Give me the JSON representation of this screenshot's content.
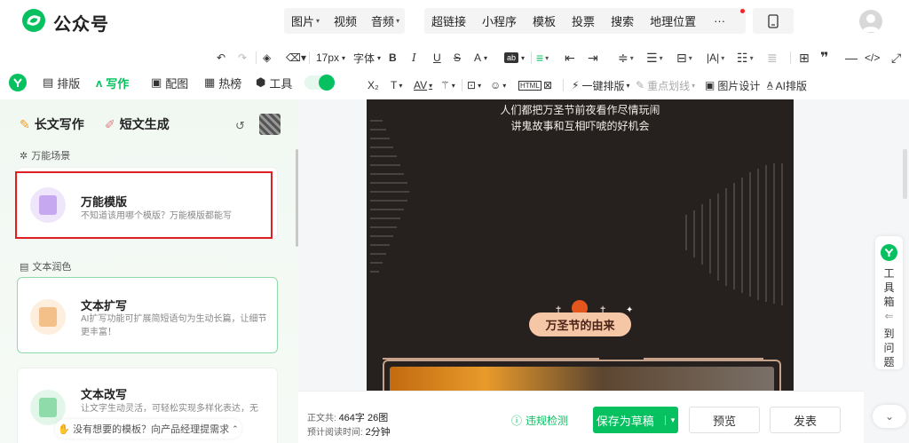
{
  "header": {
    "brand": "公众号",
    "media_menu": [
      "图片",
      "视频",
      "音频"
    ],
    "insert_menu": [
      "超链接",
      "小程序",
      "模板",
      "投票",
      "搜索",
      "地理位置"
    ],
    "more": "···"
  },
  "toolbar": {
    "font_size": "17px",
    "font_family": "字体",
    "bold": "B",
    "italic": "I",
    "underline": "U",
    "strike": "S",
    "text_color": "A",
    "row2": {
      "sub": "X₂",
      "text_style": "T",
      "spacing": "AV",
      "one_click_layout": "一键排版",
      "highlight": "重点划线",
      "image_design": "图片设计",
      "ai_layout": "AI排版"
    }
  },
  "tabs": [
    {
      "label": "排版",
      "icon": "layout-icon"
    },
    {
      "label": "写作",
      "icon": "ai-write-icon",
      "active": true
    },
    {
      "label": "配图",
      "icon": "image-icon"
    },
    {
      "label": "热榜",
      "icon": "hot-list-icon"
    },
    {
      "label": "工具",
      "icon": "tool-icon"
    }
  ],
  "left_panel": {
    "long_write": "长文写作",
    "short_generate": "短文生成",
    "section_universal": "万能场景",
    "section_polish": "文本润色",
    "cards": [
      {
        "title": "万能模版",
        "desc": "不知道该用哪个模版？万能模版都能写"
      },
      {
        "title": "文本扩写",
        "desc": "AI扩写功能可扩展简短语句为生动长篇，让细节更丰富！"
      },
      {
        "title": "文本改写",
        "desc": "让文字生动灵活，可轻松实现多样化表达，无"
      }
    ],
    "feedback": "没有想要的模板？向产品经理提需求"
  },
  "canvas": {
    "line1": "人们都把万圣节前夜看作尽情玩闹",
    "line2": "讲鬼故事和互相吓唬的好机会",
    "pill": "万圣节的由来"
  },
  "right_rail": {
    "toolbox": [
      "工",
      "具",
      "箱"
    ],
    "issue": [
      "到",
      "问",
      "题"
    ]
  },
  "footer": {
    "count_label": "正文共:",
    "count_value": "464字 26图",
    "read_label": "预计阅读时间:",
    "read_value": "2分钟",
    "check": "违规检测",
    "save_draft": "保存为草稿",
    "preview": "预览",
    "publish": "发表"
  },
  "colors": {
    "brand_green": "#07c160",
    "highlight_red": "#e02020",
    "canvas_bg": "#26201f"
  }
}
